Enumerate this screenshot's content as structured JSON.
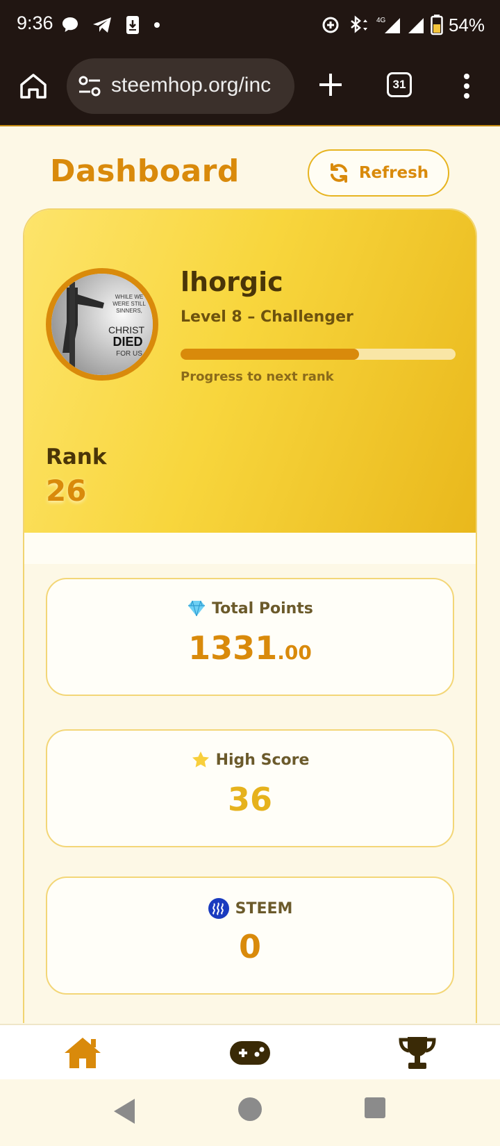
{
  "status_bar": {
    "time": "9:36",
    "battery": "54%",
    "icons": [
      "chat-bubble-icon",
      "telegram-icon",
      "download-icon",
      "dot-icon",
      "data-saver-icon",
      "bluetooth-icon",
      "network-4g-icon",
      "signal-icon",
      "signal-icon",
      "battery-icon"
    ]
  },
  "browser": {
    "url": "steemhop.org/inc",
    "tab_count": "31"
  },
  "header": {
    "title": "Dashboard",
    "refresh_label": "Refresh"
  },
  "profile": {
    "username": "lhorgic",
    "level": "Level 8 – Challenger",
    "progress_fraction": 0.65,
    "progress_label": "Progress to next rank",
    "rank_label": "Rank",
    "rank_value": "26",
    "avatar_text": [
      "WHILE WE",
      "WERE STILL",
      "SINNERS,",
      "CHRIST",
      "DIED",
      "FOR US"
    ]
  },
  "stats": [
    {
      "icon": "gem-icon",
      "label": "Total Points",
      "value_int": "1331",
      "value_dec": ".00",
      "color": "#d98a0b"
    },
    {
      "icon": "star-icon",
      "label": "High Score",
      "value_int": "36",
      "value_dec": "",
      "color": "#e6b21c"
    },
    {
      "icon": "steem-icon",
      "label": "STEEM",
      "value_int": "0",
      "value_dec": "",
      "color": "#d98a0b"
    }
  ],
  "bottom_nav": [
    "home-icon",
    "gamepad-icon",
    "trophy-icon"
  ],
  "colors": {
    "accent": "#d98a0b",
    "gold": "#e6b21c",
    "dark": "#4a3508"
  }
}
